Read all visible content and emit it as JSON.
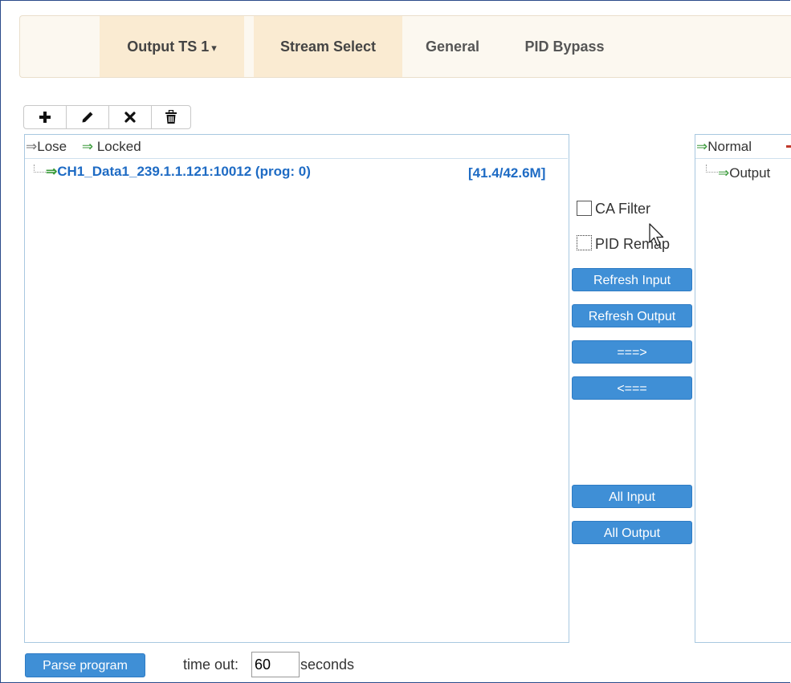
{
  "nav": {
    "output_ts": "Output TS 1",
    "output_ts_caret": "▾",
    "tabs": [
      {
        "label": "Stream Select"
      },
      {
        "label": "General"
      },
      {
        "label": "PID Bypass"
      }
    ]
  },
  "toolbar": {
    "icons": [
      "plus-icon",
      "pencil-icon",
      "close-icon",
      "trash-icon"
    ]
  },
  "input_panel": {
    "legend_lose_arrow": "⇒",
    "legend_lose": "Lose",
    "legend_locked_arrow": "⇒",
    "legend_locked": "Locked",
    "items": [
      {
        "arrow": "⇒",
        "label": "CH1_Data1_239.1.1.121:10012 (prog: 0)",
        "rate": "[41.4/42.6M]"
      }
    ]
  },
  "output_panel": {
    "legend_normal_arrow": "⇒",
    "legend_normal": "Normal",
    "items": [
      {
        "arrow": "⇒",
        "label": "Output"
      }
    ]
  },
  "options": {
    "ca_filter": "CA Filter",
    "pid_remap": "PID Remap"
  },
  "buttons": {
    "refresh_input": "Refresh Input",
    "refresh_output": "Refresh Output",
    "move_right": "===>",
    "move_left": "<===",
    "all_input": "All Input",
    "all_output": "All Output",
    "parse_program": "Parse program"
  },
  "timeout": {
    "label": "time out:",
    "value": "60",
    "unit": "seconds"
  },
  "colors": {
    "accent": "#3f8fd6",
    "active_tab": "#faebd2",
    "locked_arrow": "#3a9a3a",
    "link_text": "#1e6bc4"
  }
}
